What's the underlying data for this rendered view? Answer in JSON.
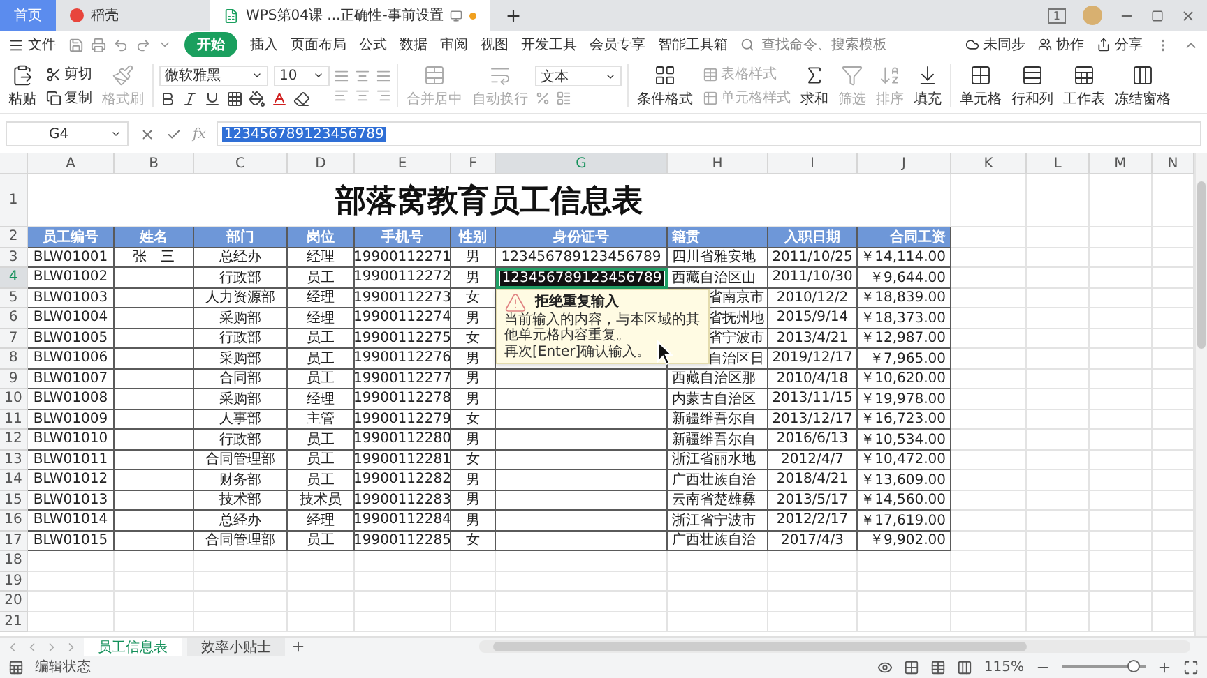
{
  "window": {
    "tabs": [
      {
        "kind": "home",
        "label": "首页",
        "selected": false
      },
      {
        "kind": "docer",
        "label": "稻壳",
        "selected": false
      },
      {
        "kind": "sheet",
        "label": "WPS第04课 ...正确性-事前设置",
        "selected": true
      }
    ],
    "badge": "1"
  },
  "menu": {
    "file": "文件",
    "tabs": [
      {
        "label": "开始",
        "selected": true
      },
      {
        "label": "插入",
        "selected": false
      },
      {
        "label": "页面布局",
        "selected": false
      },
      {
        "label": "公式",
        "selected": false
      },
      {
        "label": "数据",
        "selected": false
      },
      {
        "label": "审阅",
        "selected": false
      },
      {
        "label": "视图",
        "selected": false
      },
      {
        "label": "开发工具",
        "selected": false
      },
      {
        "label": "会员专享",
        "selected": false
      },
      {
        "label": "智能工具箱",
        "selected": false
      }
    ],
    "search": {
      "placeholder": "查找命令、搜索模板"
    },
    "actions": [
      {
        "kind": "sync",
        "label": "未同步"
      },
      {
        "kind": "collab",
        "label": "协作"
      },
      {
        "kind": "share",
        "label": "分享"
      }
    ]
  },
  "ribbon": [
    {
      "kind": "paste",
      "label": "粘贴",
      "disabled": false
    },
    {
      "kind": "pair",
      "items": [
        {
          "kind": "cut",
          "label": "剪切",
          "disabled": false
        },
        {
          "kind": "copy",
          "label": "复制",
          "disabled": false
        }
      ]
    },
    {
      "kind": "format_painter",
      "label": "格式刷",
      "disabled": true
    },
    {
      "kind": "font",
      "font": "微软雅黑",
      "size": "10"
    },
    {
      "kind": "alignment"
    },
    {
      "kind": "merge",
      "label": "合并居中",
      "disabled": true
    },
    {
      "kind": "wrap",
      "label": "自动换行",
      "disabled": true
    },
    {
      "kind": "number",
      "format": "文本"
    },
    {
      "kind": "conditional",
      "label": "条件格式",
      "disabled": false
    },
    {
      "kind": "pair",
      "items": [
        {
          "kind": "table_style",
          "label": "表格样式",
          "disabled": true
        },
        {
          "kind": "cell_style",
          "label": "单元格样式",
          "disabled": true
        }
      ]
    },
    {
      "kind": "sum",
      "label": "求和",
      "disabled": false
    },
    {
      "kind": "filter",
      "label": "筛选",
      "disabled": true
    },
    {
      "kind": "sort",
      "label": "排序",
      "disabled": true
    },
    {
      "kind": "fill",
      "label": "填充",
      "disabled": false
    },
    {
      "kind": "cells",
      "label": "单元格",
      "disabled": false
    },
    {
      "kind": "rows_cols",
      "label": "行和列",
      "disabled": false
    },
    {
      "kind": "worksheet",
      "label": "工作表",
      "disabled": false
    },
    {
      "kind": "freeze",
      "label": "冻结窗格",
      "disabled": false
    }
  ],
  "formula_bar": {
    "name_box": "G4",
    "function_label": "fx",
    "value": "123456789123456789"
  },
  "sheet": {
    "columns": [
      {
        "label": "A",
        "selected": false
      },
      {
        "label": "B",
        "selected": false
      },
      {
        "label": "C",
        "selected": false
      },
      {
        "label": "D",
        "selected": false
      },
      {
        "label": "E",
        "selected": false
      },
      {
        "label": "F",
        "selected": false
      },
      {
        "label": "G",
        "selected": true
      },
      {
        "label": "H",
        "selected": false
      },
      {
        "label": "I",
        "selected": false
      },
      {
        "label": "J",
        "selected": false
      },
      {
        "label": "K",
        "selected": false
      },
      {
        "label": "L",
        "selected": false
      },
      {
        "label": "M",
        "selected": false
      },
      {
        "label": "N",
        "selected": false
      }
    ],
    "rows": [
      {
        "num": "1",
        "kind": "title",
        "selected": false,
        "text": "部落窝教育员工信息表"
      },
      {
        "num": "2",
        "kind": "header",
        "selected": false,
        "cells": [
          "员工编号",
          "姓名",
          "部门",
          "岗位",
          "手机号",
          "性别",
          "身份证号",
          "籍贯",
          "入职日期",
          "合同工资"
        ]
      },
      {
        "num": "3",
        "kind": "data",
        "selected": false,
        "covered": false,
        "cells": [
          "BLW01001",
          "张　三",
          "总经办",
          "经理",
          "19900112271",
          "男",
          "123456789123456789",
          "四川省雅安地",
          "2011/10/25",
          "￥14,114.00"
        ]
      },
      {
        "num": "4",
        "kind": "data",
        "selected": true,
        "covered": false,
        "cells": [
          "BLW01002",
          null,
          "行政部",
          "员工",
          "19900112272",
          "男",
          "123456789123456789",
          "西藏自治区山",
          "2011/10/30",
          "￥9,644.00"
        ]
      },
      {
        "num": "5",
        "kind": "data",
        "selected": false,
        "covered": true,
        "cells": [
          "BLW01003",
          null,
          "人力资源部",
          "经理",
          "19900112273",
          "女",
          null,
          "省南京市",
          "2010/12/2",
          "￥18,839.00"
        ]
      },
      {
        "num": "6",
        "kind": "data",
        "selected": false,
        "covered": true,
        "cells": [
          "BLW01004",
          null,
          "采购部",
          "经理",
          "19900112274",
          "男",
          null,
          "省抚州地",
          "2015/9/14",
          "￥18,373.00"
        ]
      },
      {
        "num": "7",
        "kind": "data",
        "selected": false,
        "covered": true,
        "cells": [
          "BLW01005",
          null,
          "行政部",
          "员工",
          "19900112275",
          "女",
          null,
          "省宁波市",
          "2013/4/21",
          "￥12,987.00"
        ]
      },
      {
        "num": "8",
        "kind": "data",
        "selected": false,
        "covered": true,
        "cells": [
          "BLW01006",
          null,
          "采购部",
          "员工",
          "19900112276",
          "男",
          null,
          "自治区日",
          "2019/12/17",
          "￥7,965.00"
        ]
      },
      {
        "num": "9",
        "kind": "data",
        "selected": false,
        "covered": false,
        "cells": [
          "BLW01007",
          null,
          "合同部",
          "员工",
          "19900112277",
          "男",
          null,
          "西藏自治区那",
          "2010/4/18",
          "￥10,620.00"
        ]
      },
      {
        "num": "10",
        "kind": "data",
        "selected": false,
        "covered": false,
        "cells": [
          "BLW01008",
          null,
          "采购部",
          "经理",
          "19900112278",
          "男",
          null,
          "内蒙古自治区",
          "2013/11/15",
          "￥19,978.00"
        ]
      },
      {
        "num": "11",
        "kind": "data",
        "selected": false,
        "covered": false,
        "cells": [
          "BLW01009",
          null,
          "人事部",
          "主管",
          "19900112279",
          "女",
          null,
          "新疆维吾尔自",
          "2013/12/17",
          "￥16,723.00"
        ]
      },
      {
        "num": "12",
        "kind": "data",
        "selected": false,
        "covered": false,
        "cells": [
          "BLW01010",
          null,
          "行政部",
          "员工",
          "19900112280",
          "男",
          null,
          "新疆维吾尔自",
          "2016/6/13",
          "￥10,534.00"
        ]
      },
      {
        "num": "13",
        "kind": "data",
        "selected": false,
        "covered": false,
        "cells": [
          "BLW01011",
          null,
          "合同管理部",
          "员工",
          "19900112281",
          "女",
          null,
          "浙江省丽水地",
          "2012/4/7",
          "￥10,472.00"
        ]
      },
      {
        "num": "14",
        "kind": "data",
        "selected": false,
        "covered": false,
        "cells": [
          "BLW01012",
          null,
          "财务部",
          "员工",
          "19900112282",
          "男",
          null,
          "广西壮族自治",
          "2018/4/21",
          "￥13,609.00"
        ]
      },
      {
        "num": "15",
        "kind": "data",
        "selected": false,
        "covered": false,
        "cells": [
          "BLW01013",
          null,
          "技术部",
          "技术员",
          "19900112283",
          "男",
          null,
          "云南省楚雄彝",
          "2013/5/17",
          "￥14,560.00"
        ]
      },
      {
        "num": "16",
        "kind": "data",
        "selected": false,
        "covered": false,
        "cells": [
          "BLW01014",
          null,
          "总经办",
          "经理",
          "19900112284",
          "男",
          null,
          "浙江省宁波市",
          "2012/2/17",
          "￥17,619.00"
        ]
      },
      {
        "num": "17",
        "kind": "data",
        "selected": false,
        "covered": false,
        "cells": [
          "BLW01015",
          null,
          "合同管理部",
          "员工",
          "19900112285",
          "女",
          null,
          "广西壮族自治",
          "2017/4/3",
          "￥9,902.00"
        ]
      },
      {
        "num": "18",
        "kind": "empty",
        "selected": false
      },
      {
        "num": "19",
        "kind": "empty",
        "selected": false
      },
      {
        "num": "20",
        "kind": "empty",
        "selected": false
      },
      {
        "num": "21",
        "kind": "empty",
        "selected": false
      }
    ],
    "tooltip": {
      "title": "拒绝重复输入",
      "paragraphs": [
        "当前输入的内容，与本区域的其他单元格内容重复。",
        "再次[Enter]确认输入。"
      ]
    }
  },
  "sheet_tabs": [
    {
      "label": "员工信息表",
      "selected": true
    },
    {
      "label": "效率小贴士",
      "selected": false
    }
  ],
  "status_bar": {
    "mode": "编辑状态",
    "zoom": {
      "reading": "115%",
      "level": 0.85
    }
  }
}
